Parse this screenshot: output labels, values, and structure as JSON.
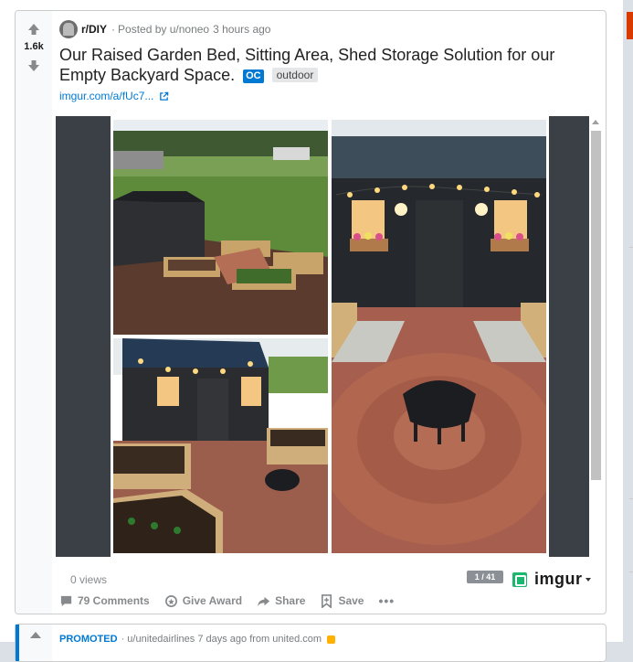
{
  "post": {
    "subreddit": "r/DIY",
    "posted_by": "Posted by u/noneo",
    "time_ago": "3 hours ago",
    "votes": "1.6k",
    "title": "Our Raised Garden Bed, Sitting Area, Shed Storage Solution for our Empty Backyard Space.",
    "oc_badge": "OC",
    "flair": "outdoor",
    "link_text": "imgur.com/a/fUc7...",
    "views": "0 views",
    "gallery_counter": "1 / 41",
    "embed_brand": "imgur",
    "actions": {
      "comments": "79 Comments",
      "award": "Give Award",
      "share": "Share",
      "save": "Save",
      "more": "•••"
    }
  },
  "promoted": {
    "label": "PROMOTED",
    "meta": "· u/unitedairlines 7 days ago from united.com"
  },
  "colors": {
    "accent": "#0079d3",
    "imgur_green": "#1bb76e",
    "vote_bg": "#f8f9fa",
    "media_dark": "#3b4047"
  },
  "icons": {
    "upvote": "upvote-icon",
    "downvote": "downvote-icon",
    "external_link": "external-link-icon",
    "comments": "comment-icon",
    "award": "award-icon",
    "share": "share-icon",
    "save": "save-icon",
    "lock": "lock-icon"
  }
}
